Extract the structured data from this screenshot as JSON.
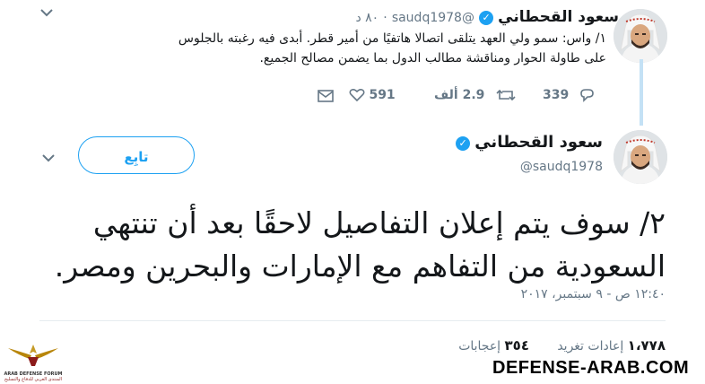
{
  "tweet1": {
    "name": "سعود القحطاني",
    "handle": "@saudq1978",
    "time": "٨٠ د",
    "text_line1": "١/ واس: سمو ولي العهد يتلقى اتصالا هاتفيًا من أمير قطر. أبدى فيه رغبته بالجلوس",
    "text_line2": "على طاولة الحوار ومناقشة مطالب الدول بما يضمن مصالح الجميع.",
    "replies": "339",
    "retweets": "2.9 ألف",
    "likes": "591"
  },
  "tweet2": {
    "name": "سعود القحطاني",
    "handle": "@saudq1978",
    "follow_label": "تابِع",
    "text_line1": "٢/ سوف يتم إعلان التفاصيل لاحقًا بعد أن تنتهي",
    "text_line2": "السعودية من التفاهم مع الإمارات والبحرين ومصر.",
    "timestamp": "١٢:٤٠ ص - ٩ سبتمبر، ٢٠١٧",
    "retweets_count": "١،٧٧٨",
    "retweets_label": "إعادات تغريد",
    "likes_count": "٣٥٤",
    "likes_label": "إعجابات"
  },
  "watermark": {
    "site": "DEFENSE-ARAB.COM",
    "logo_text": "ARAB DEFENSE FORUM",
    "logo_subtext": "المنتدى العربي للدفاع والتسليح"
  },
  "icons": {
    "verified": "verified-badge-icon",
    "reply": "reply-icon",
    "retweet": "retweet-icon",
    "like": "heart-icon",
    "dm": "envelope-icon",
    "more": "chevron-down-icon"
  },
  "colors": {
    "accent": "#1da1f2",
    "muted": "#657786",
    "thread": "#c4e1f5"
  }
}
